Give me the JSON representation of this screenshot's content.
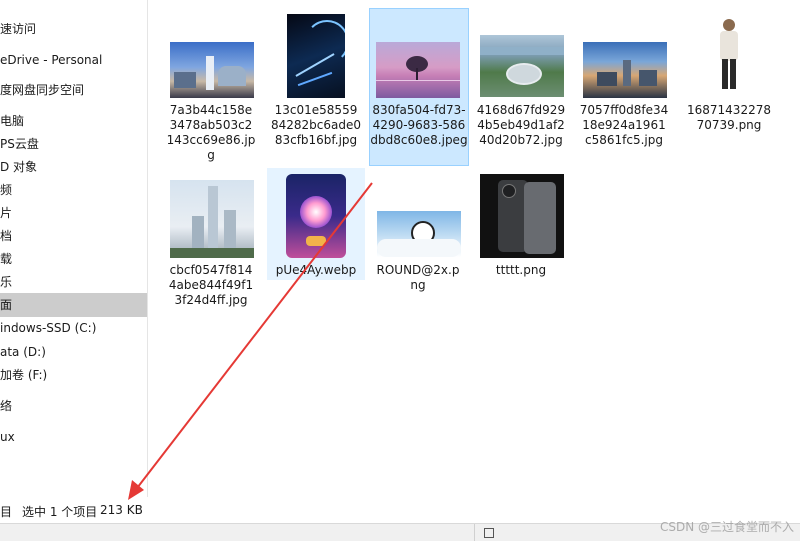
{
  "nav": {
    "items": [
      {
        "label": "速访问"
      },
      {
        "label": "eDrive - Personal"
      },
      {
        "label": "度网盘同步空间"
      },
      {
        "label": "电脑"
      },
      {
        "label": "PS云盘"
      },
      {
        "label": "D 对象"
      },
      {
        "label": "频"
      },
      {
        "label": "片"
      },
      {
        "label": "档"
      },
      {
        "label": "载"
      },
      {
        "label": "乐"
      },
      {
        "label": "面",
        "selected": true
      },
      {
        "label": "indows-SSD (C:)"
      },
      {
        "label": "ata (D:)"
      },
      {
        "label": "加卷 (F:)"
      },
      {
        "label": "络"
      },
      {
        "label": "ux"
      }
    ]
  },
  "files": [
    {
      "name": "7a3b44c158e3478ab503c2143cc69e86.jpg",
      "state": "normal"
    },
    {
      "name": "13c01e5855984282bc6ade083cfb16bf.jpg",
      "state": "normal"
    },
    {
      "name": "830fa504-fd73-4290-9683-586dbd8c60e8.jpeg",
      "state": "selected"
    },
    {
      "name": "4168d67fd9294b5eb49d1af240d20b72.jpg",
      "state": "normal"
    },
    {
      "name": "7057ff0d8fe3418e924a1961c5861fc5.jpg",
      "state": "normal"
    },
    {
      "name": "1687143227870739.png",
      "state": "normal"
    },
    {
      "name": "cbcf0547f8144abe844f49f13f24d4ff.jpg",
      "state": "normal"
    },
    {
      "name": "pUe4Ay.webp",
      "state": "hover"
    },
    {
      "name": "ROUND@2x.png",
      "state": "normal"
    },
    {
      "name": "ttttt.png",
      "state": "normal"
    }
  ],
  "status": {
    "view_label": "目",
    "selection_text": "选中 1 个项目",
    "size_text": "213 KB"
  },
  "watermark": "CSDN @三过食堂而不入",
  "colors": {
    "selected_bg": "#cce8ff",
    "selected_border": "#99d1ff",
    "nav_selected_bg": "#cccccc",
    "arrow": "#e53935"
  }
}
